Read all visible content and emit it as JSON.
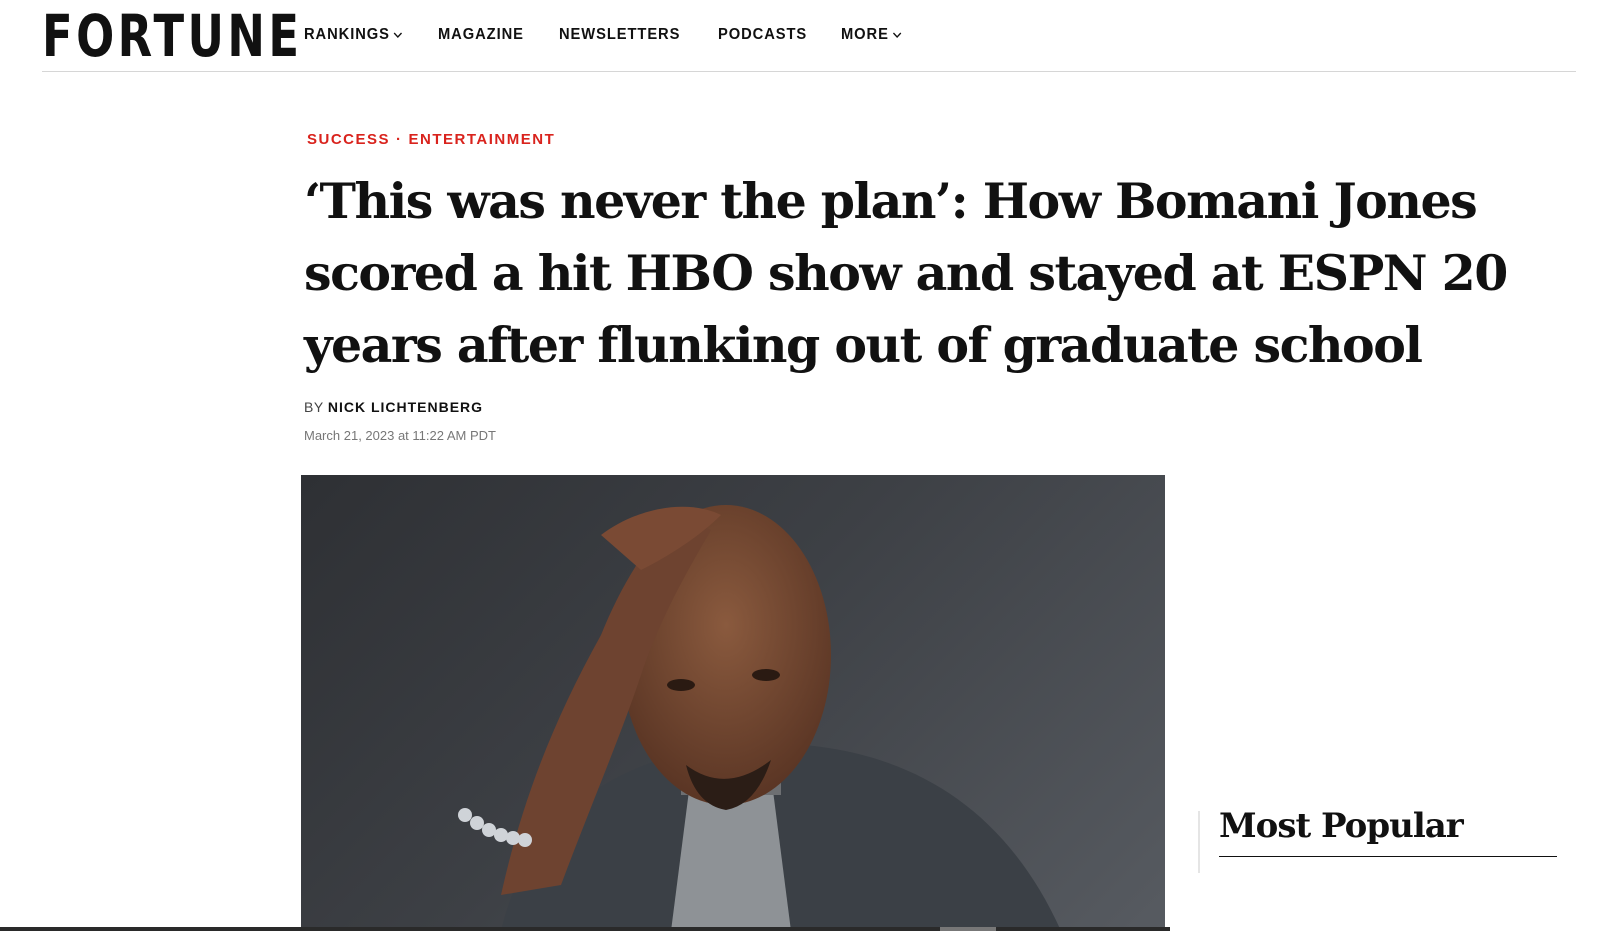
{
  "brand": {
    "logo": "FORTUNE"
  },
  "nav": [
    {
      "label": "RANKINGS",
      "dropdown": true
    },
    {
      "label": "MAGAZINE",
      "dropdown": false
    },
    {
      "label": "NEWSLETTERS",
      "dropdown": false
    },
    {
      "label": "PODCASTS",
      "dropdown": false
    },
    {
      "label": "MORE",
      "dropdown": true
    }
  ],
  "article": {
    "categories": [
      "SUCCESS",
      "ENTERTAINMENT"
    ],
    "category_separator": "·",
    "headline": "‘This was never the plan’: How Bomani Jones scored a hit HBO show and stayed at ESPN 20 years after flunking out of graduate school",
    "byline_prefix": "BY",
    "author": "NICK LICHTENBERG",
    "date": "March 21, 2023 at 11:22 AM PDT"
  },
  "sidebar": {
    "most_popular_title": "Most Popular"
  },
  "colors": {
    "accent_red": "#d9231d",
    "text": "#111111"
  }
}
